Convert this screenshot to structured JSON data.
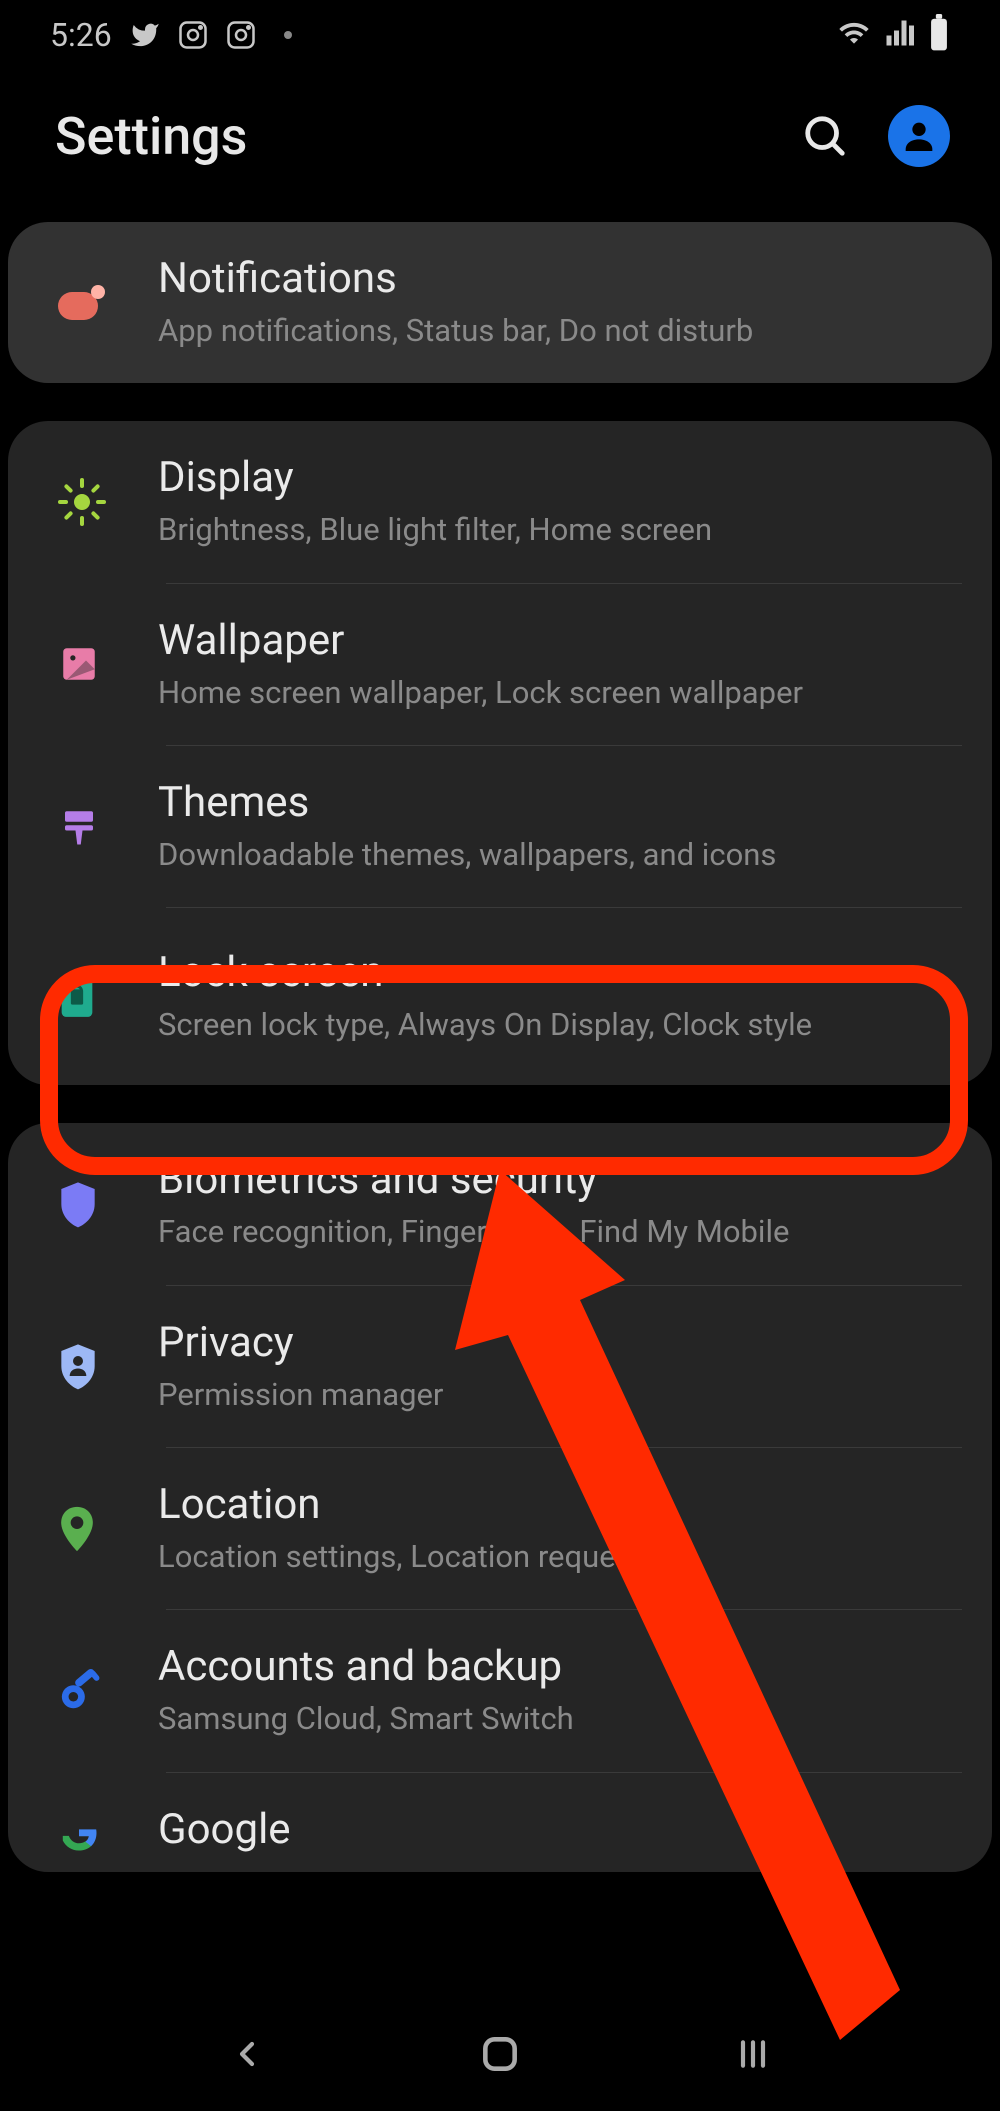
{
  "status_bar": {
    "time": "5:26",
    "icons_left": [
      "twitter",
      "instagram",
      "instagram"
    ],
    "icons_right": [
      "wifi",
      "signal",
      "battery"
    ]
  },
  "header": {
    "title": "Settings"
  },
  "groups": [
    {
      "highlight": true,
      "items": [
        {
          "id": "notifications",
          "icon": "toggle-icon",
          "icon_color": "#e56b5d",
          "title": "Notifications",
          "subtitle": "App notifications, Status bar, Do not disturb"
        }
      ]
    },
    {
      "items": [
        {
          "id": "display",
          "icon": "sun-icon",
          "icon_color": "#a5d63f",
          "title": "Display",
          "subtitle": "Brightness, Blue light filter, Home screen"
        },
        {
          "id": "wallpaper",
          "icon": "image-icon",
          "icon_color": "#e87ca8",
          "title": "Wallpaper",
          "subtitle": "Home screen wallpaper, Lock screen wallpaper"
        },
        {
          "id": "themes",
          "icon": "brush-icon",
          "icon_color": "#b57de8",
          "title": "Themes",
          "subtitle": "Downloadable themes, wallpapers, and icons"
        },
        {
          "id": "lock-screen",
          "icon": "lock-icon",
          "icon_color": "#1fab8e",
          "title": "Lock screen",
          "subtitle": "Screen lock type, Always On Display, Clock style",
          "highlighted": true
        }
      ]
    },
    {
      "items": [
        {
          "id": "biometrics",
          "icon": "shield-icon",
          "icon_color": "#7b7bf5",
          "title": "Biometrics and security",
          "subtitle": "Face recognition, Fingerprints, Find My Mobile"
        },
        {
          "id": "privacy",
          "icon": "shield-person-icon",
          "icon_color": "#9db8f5",
          "title": "Privacy",
          "subtitle": "Permission manager"
        },
        {
          "id": "location",
          "icon": "pin-icon",
          "icon_color": "#5aaf4f",
          "title": "Location",
          "subtitle": "Location settings, Location requests"
        },
        {
          "id": "accounts",
          "icon": "key-icon",
          "icon_color": "#2b6be8",
          "title": "Accounts and backup",
          "subtitle": "Samsung Cloud, Smart Switch"
        },
        {
          "id": "google",
          "icon": "google-icon",
          "icon_color": "#4285f4",
          "title": "Google",
          "subtitle": ""
        }
      ]
    }
  ],
  "annotation": {
    "highlight_item": "lock-screen"
  }
}
